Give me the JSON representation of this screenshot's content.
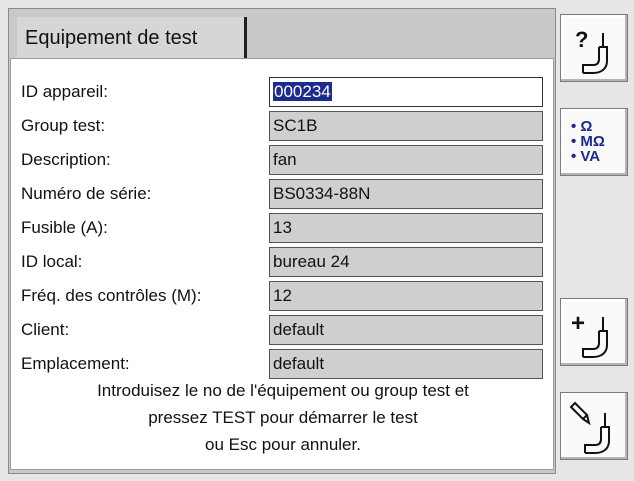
{
  "tab": {
    "title": "Equipement de test"
  },
  "form": {
    "fields": [
      {
        "label": "ID appareil:",
        "value": "000234"
      },
      {
        "label": "Group test:",
        "value": "SC1B"
      },
      {
        "label": "Description:",
        "value": "fan"
      },
      {
        "label": "Numéro de série:",
        "value": "BS0334-88N"
      },
      {
        "label": "Fusible (A):",
        "value": "13"
      },
      {
        "label": "ID local:",
        "value": "bureau 24"
      },
      {
        "label": "Fréq. des contrôles (M):",
        "value": "12"
      },
      {
        "label": "Client:",
        "value": "default"
      },
      {
        "label": "Emplacement:",
        "value": "default"
      }
    ]
  },
  "message": {
    "line1": "Introduisez le no de l'équipement ou group test et",
    "line2": "pressez TEST pour démarrer le test",
    "line3": "ou Esc pour annuler."
  },
  "sidebar": {
    "help": {
      "icon": "help-probe-icon",
      "glyph": "?"
    },
    "units": {
      "icon": "units-icon",
      "line1": "• Ω",
      "line2": "• MΩ",
      "line3": "• VA"
    },
    "add": {
      "icon": "add-probe-icon",
      "glyph": "+"
    },
    "edit": {
      "icon": "edit-probe-icon"
    }
  },
  "colors": {
    "accent": "#1c2b8f",
    "field_bg": "#cfcfcf",
    "panel_bg": "#c9c9c9"
  }
}
